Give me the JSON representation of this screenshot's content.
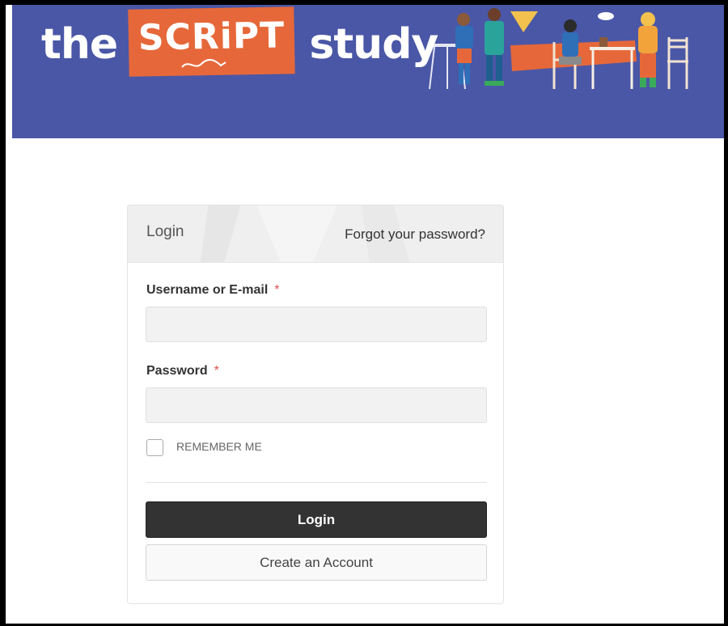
{
  "banner": {
    "brand_the": "the",
    "brand_script": "SCRiPT",
    "brand_study": "study",
    "background_color": "#4a57a6",
    "script_color": "#e6683a",
    "illustration_icon": "people-at-table-illustration"
  },
  "login": {
    "title": "Login",
    "forgot_password": "Forgot your password?",
    "username_label": "Username or E-mail",
    "password_label": "Password",
    "required_marker": "*",
    "username_value": "",
    "password_value": "",
    "remember_me_label": "REMEMBER ME",
    "remember_me_checked": false,
    "login_button": "Login",
    "create_account_button": "Create an Account"
  }
}
